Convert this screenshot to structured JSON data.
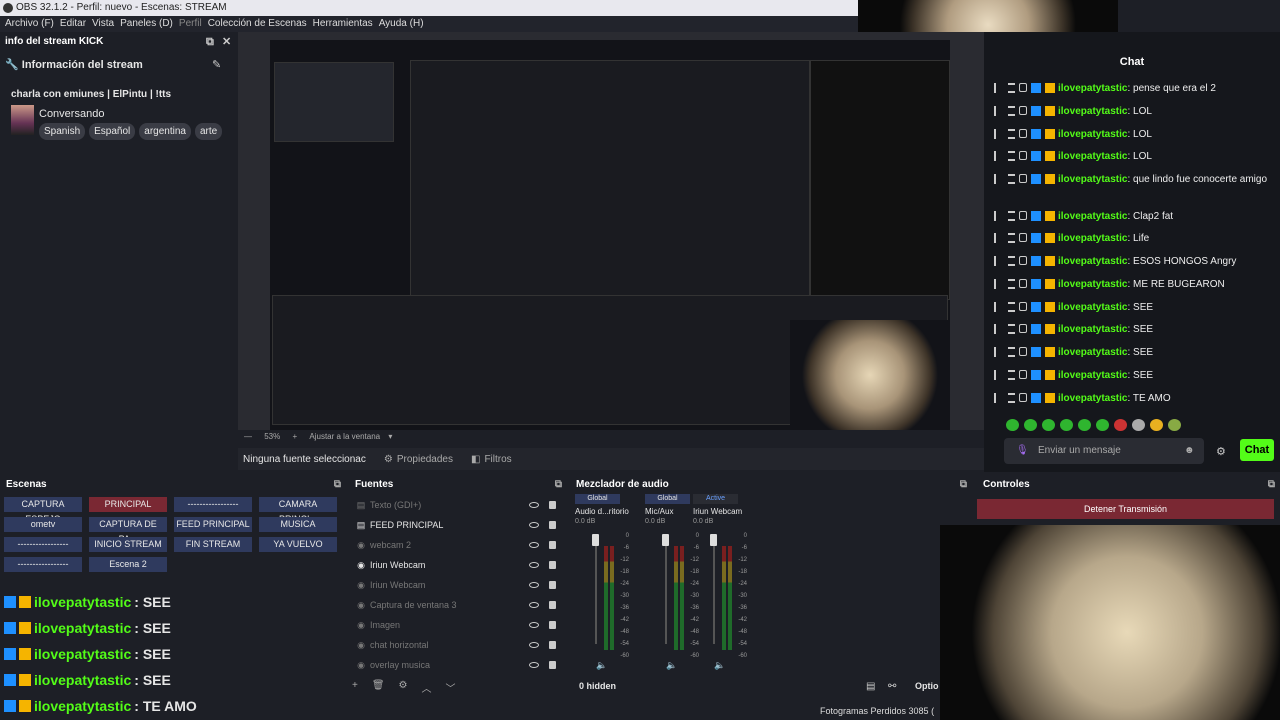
{
  "window": {
    "title": "OBS 32.1.2 - Perfil: nuevo - Escenas: STREAM"
  },
  "menu": [
    "Archivo (F)",
    "Editar",
    "Vista",
    "Paneles (D)",
    "Perfil",
    "Colección de Escenas",
    "Herramientas",
    "Ayuda (H)"
  ],
  "info_panel": {
    "dock_title": "info del stream KICK",
    "header": "Información del stream",
    "stream_title": "charla con emiunes | ElPintu | !tts",
    "category": "Conversando",
    "tags": [
      "Spanish",
      "Español",
      "argentina",
      "arte"
    ]
  },
  "preview": {
    "zoom": "53%",
    "fit_label": "Ajustar a la ventana"
  },
  "properties_bar": {
    "no_source": "Ninguna fuente seleccionac",
    "props_label": "Propiedades",
    "filters_label": "Filtros"
  },
  "chat": {
    "title": "Chat",
    "messages": [
      {
        "user": "ilovepatytastic",
        "text": ": pense que era el 2"
      },
      {
        "user": "ilovepatytastic",
        "text": ": LOL"
      },
      {
        "user": "ilovepatytastic",
        "text": ": LOL"
      },
      {
        "user": "ilovepatytastic",
        "text": ": LOL"
      },
      {
        "user": "ilovepatytastic",
        "text": ": que lindo fue conocerte amigo"
      },
      {
        "user": "ilovepatytastic",
        "text": ": Clap2 fat"
      },
      {
        "user": "ilovepatytastic",
        "text": ": Life"
      },
      {
        "user": "ilovepatytastic",
        "text": ": ESOS HONGOS Angry"
      },
      {
        "user": "ilovepatytastic",
        "text": ": ME RE BUGEARON"
      },
      {
        "user": "ilovepatytastic",
        "text": ": SEE"
      },
      {
        "user": "ilovepatytastic",
        "text": ": SEE"
      },
      {
        "user": "ilovepatytastic",
        "text": ": SEE"
      },
      {
        "user": "ilovepatytastic",
        "text": ": SEE"
      },
      {
        "user": "ilovepatytastic",
        "text": ": TE AMO"
      }
    ],
    "input_placeholder": "Enviar un mensaje",
    "send_label": "Chat"
  },
  "scenes": {
    "title": "Escenas",
    "items": [
      "CAPTURA ESPEJO",
      "PRINCIPAL",
      "-----------------",
      "CAMARA PRINCI...",
      "ometv",
      "CAPTURA DE PA...",
      "FEED PRINCIPAL",
      "MUSICA",
      "-----------------",
      "INICIO STREAM",
      "FIN STREAM",
      "YA VUELVO",
      "-----------------",
      "Escena 2"
    ],
    "active": "PRINCIPAL"
  },
  "overlay_chat": [
    {
      "user": "ilovepatytastic",
      "text": " : SEE"
    },
    {
      "user": "ilovepatytastic",
      "text": " : SEE"
    },
    {
      "user": "ilovepatytastic",
      "text": " : SEE"
    },
    {
      "user": "ilovepatytastic",
      "text": " : SEE"
    },
    {
      "user": "ilovepatytastic",
      "text": " : TE AMO"
    }
  ],
  "sources": {
    "title": "Fuentes",
    "items": [
      {
        "name": "Texto (GDI+)",
        "dim": true
      },
      {
        "name": "FEED PRINCIPAL",
        "dim": false
      },
      {
        "name": "webcam 2",
        "dim": true
      },
      {
        "name": "Iriun Webcam",
        "dim": false
      },
      {
        "name": "Iriun Webcam",
        "dim": true
      },
      {
        "name": "Captura de ventana 3",
        "dim": true
      },
      {
        "name": "Imagen",
        "dim": true
      },
      {
        "name": "chat horizontal",
        "dim": true
      },
      {
        "name": "overlay musica",
        "dim": true
      }
    ]
  },
  "mixer": {
    "title": "Mezclador de audio",
    "channels": [
      {
        "tag": "Global",
        "name": "Audio d...ritorio",
        "db": "0.0 dB"
      },
      {
        "tag": "Global",
        "name": "Mic/Aux",
        "db": "0.0 dB"
      },
      {
        "tag": "Active",
        "name": "Iriun Webcam",
        "db": "0.0 dB"
      }
    ],
    "ticks": [
      "0",
      "-6",
      "-12",
      "-18",
      "-24",
      "-30",
      "-36",
      "-42",
      "-48",
      "-54",
      "-60"
    ],
    "hidden_label": "0 hidden"
  },
  "controls": {
    "title": "Controles",
    "stop_label": "Detener Transmisión",
    "options_label": "Optio"
  },
  "status": {
    "dropped": "Fotogramas Perdidos 3085 ("
  },
  "colors": {
    "kick_green": "#53fc18",
    "scene_active": "#7a2833",
    "scene": "#2f3a5e"
  }
}
